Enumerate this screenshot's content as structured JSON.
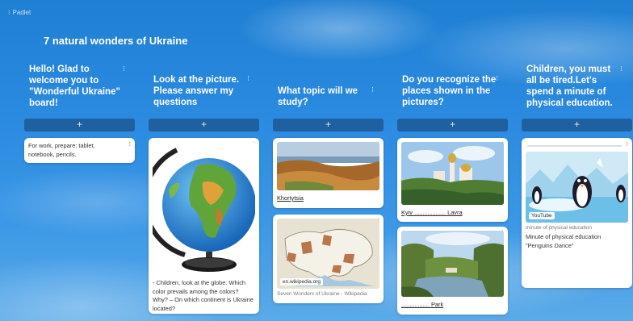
{
  "app": {
    "brand": "Padlet"
  },
  "board": {
    "title": "7 natural wonders of Ukraine"
  },
  "add_label": "+",
  "columns": [
    {
      "title": "Hello! Glad to welcome you to \"Wonderful Ukraine\" board!",
      "cards": [
        {
          "text": "For work, prepare: tablet, notebook, pencils."
        }
      ]
    },
    {
      "title": "Look at the picture. Please answer my questions",
      "cards": [
        {
          "text": "- Children, look at the globe. Which color prevails among the colors? Why? – On which continent is Ukraine located?"
        }
      ]
    },
    {
      "title": "What topic will we study?",
      "cards": [
        {
          "link": "Khortytsia"
        },
        {
          "badge": "en.wikipedia.org",
          "source": "Seven Wonders of Ukraine - Wikipedia"
        }
      ]
    },
    {
      "title": "Do you recognize the places shown in the pictures?",
      "cards": [
        {
          "link": "Kyiv ................... Lavra"
        },
        {
          "link": "................. Park"
        }
      ]
    },
    {
      "title": "Children, you must all be tired.Let's spend a minute of physical education.",
      "cards": [
        {
          "badge": "YouTube",
          "source": "minute of physical education",
          "text": "Minute of physical education \"Penguins Dance\""
        }
      ]
    }
  ],
  "colors": {
    "accent_bar": "#1e4a7a",
    "sky": "#2a8ae0"
  }
}
